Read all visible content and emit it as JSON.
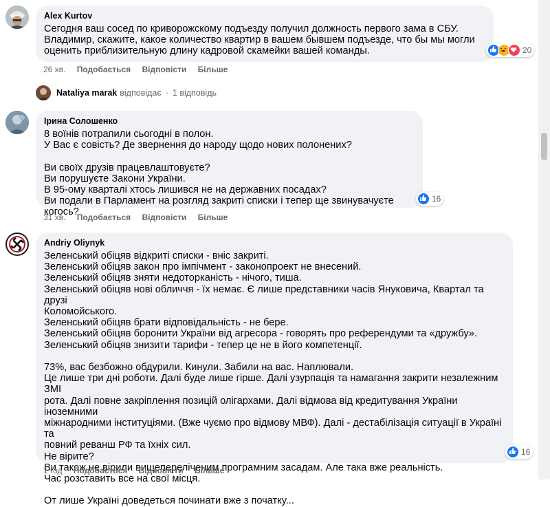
{
  "comments": [
    {
      "author": "Alex Kurtov",
      "text": "Сегодня ваш сосед по криворожскому подъезду получил должность первого зама в СБУ.\nВладимир, скажите, какое количество квартир в вашем бывшем подъезде, что бы мы могли\nоценить приблизительную длину кадровой скамейки вашей команды.",
      "time": "26 хв.",
      "like": "Подобається",
      "reply": "Відповісти",
      "more": "Більше",
      "reaction_count": "20",
      "reactions": [
        "like-icon",
        "haha-icon",
        "love-icon"
      ]
    },
    {
      "author": "Ірина Солошенко",
      "text": "8 воїнів потрапили сьогодні в полон.\nУ Вас є совість? Де звернення до народу щодо нових полонених?\n\nВи своїх друзів працевлаштовуєте?\nВи порушуєте Закони України.\nВ 95-ому кварталі хтось лишився не на державних посадах?\nВи подали в Парламент на розгляд закриті списки і тепер ще звинувачуєте когось?",
      "time": "31 хв.",
      "like": "Подобається",
      "reply": "Відповісти",
      "more": "Більше",
      "reaction_count": "16",
      "reactions": [
        "like-icon"
      ]
    },
    {
      "author": "Andriy Oliynyk",
      "text": "Зеленський обіцяв відкриті списки - вніс закриті.\nЗеленський обіцяв закон про імпічмент - законопроект не внесений.\nЗеленський обіцяв зняти недоторканість - нічого, тиша.\nЗеленський обіцяв нові обличчя - їх немає. Є лише представники часів Януковича, Квартал та друзі\nКоломойського.\nЗеленський обіцяв брати відповідальність - не бере.\nЗеленський обіцяв боронити України від агресора - говорять про референдуми та «дружбу».\nЗеленський обіцяв знизити тарифи - тепер це не в його компетенції.\n\n73%, вас безбожно обдурили. Кинули. Забили на вас. Наплювали.\nЦе лише три дні роботи. Далі буде лише гірше. Далі узурпація та намагання закрити незалежним ЗМІ\nрота. Далі повне закріплення позицій олігархами. Далі відмова від кредитування України іноземними\nміжнародними інституціями. (Вже чуємо про відмову МВФ). Далі - дестабілізація ситуації в Україні та\nповний реванш РФ та їхніх сил.\nНе вірите?\nВи також не вірили вищепереліченим програмним засадам. Але така вже реальність.\nЧас розставить все на свої місця.\n\nОт лише Україні доведеться починати вже з початку...",
      "time": "1 год",
      "like": "Подобається",
      "reply": "Відповісти",
      "more": "Більше",
      "reaction_count": "16",
      "reactions": [
        "like-icon"
      ]
    }
  ],
  "reply_summary": {
    "author": "Nataliya marak",
    "verb": "відповідає",
    "separator": "·",
    "count": "1 відповідь"
  },
  "colors": {
    "bubble": "#f0f2f5",
    "like_blue": "#1877f2",
    "haha_yellow": "#f7b125",
    "love_red": "#f33e58",
    "meta_gray": "#65676b"
  }
}
